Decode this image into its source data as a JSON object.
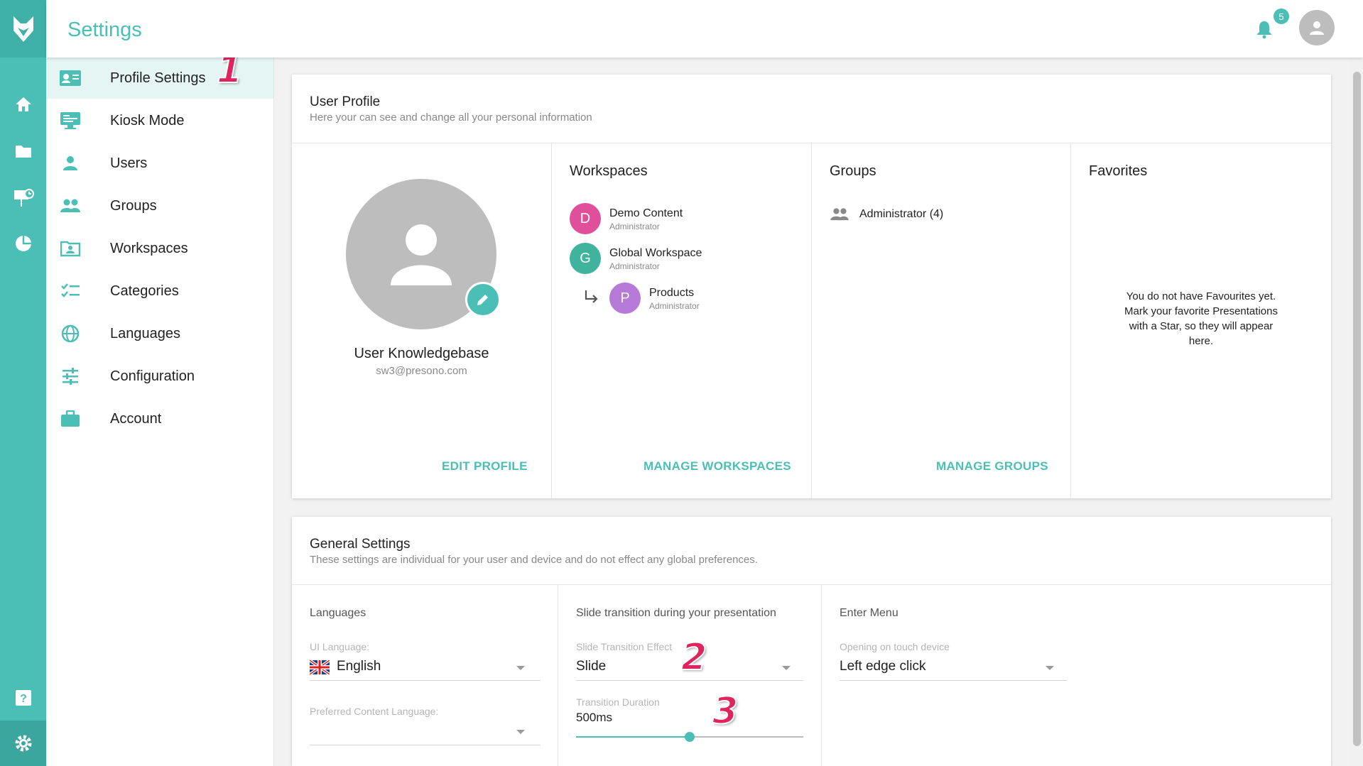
{
  "topbar": {
    "title": "Settings",
    "notification_count": "5"
  },
  "sidebar": {
    "items": [
      {
        "label": "Profile Settings",
        "icon": "profile-card-icon"
      },
      {
        "label": "Kiosk Mode",
        "icon": "monitor-icon"
      },
      {
        "label": "Users",
        "icon": "user-icon"
      },
      {
        "label": "Groups",
        "icon": "group-icon"
      },
      {
        "label": "Workspaces",
        "icon": "workspace-icon"
      },
      {
        "label": "Categories",
        "icon": "checklist-icon"
      },
      {
        "label": "Languages",
        "icon": "globe-icon"
      },
      {
        "label": "Configuration",
        "icon": "sliders-icon"
      },
      {
        "label": "Account",
        "icon": "briefcase-icon"
      }
    ]
  },
  "profile_card": {
    "title": "User Profile",
    "subtitle": "Here your can see and change all your personal information",
    "user": {
      "name": "User Knowledgebase",
      "email": "sw3@presono.com"
    },
    "edit_profile": "EDIT PROFILE",
    "workspaces": {
      "title": "Workspaces",
      "items": [
        {
          "initial": "D",
          "name": "Demo Content",
          "role": "Administrator",
          "color": "#e0509a"
        },
        {
          "initial": "G",
          "name": "Global Workspace",
          "role": "Administrator",
          "color": "#3fb39b"
        },
        {
          "initial": "P",
          "name": "Products",
          "role": "Administrator",
          "color": "#b57ad8"
        }
      ],
      "manage": "MANAGE WORKSPACES"
    },
    "groups": {
      "title": "Groups",
      "items": [
        {
          "name": "Administrator (4)"
        }
      ],
      "manage": "MANAGE GROUPS"
    },
    "favorites": {
      "title": "Favorites",
      "empty_line1": "You do not have Favourites yet.",
      "empty_line2": "Mark your favorite Presentations",
      "empty_line3": "with a Star, so they will appear",
      "empty_line4": "here."
    }
  },
  "general_card": {
    "title": "General Settings",
    "subtitle": "These settings are individual for your user and device and do not effect any global preferences.",
    "languages": {
      "section": "Languages",
      "ui_label": "UI Language:",
      "ui_value": "English",
      "content_label": "Preferred Content Language:",
      "content_value": ""
    },
    "transition": {
      "section": "Slide transition during your presentation",
      "effect_label": "Slide Transition Effect",
      "effect_value": "Slide",
      "duration_label": "Transition Duration",
      "duration_value": "500ms",
      "slider_fraction": 0.5
    },
    "enter_menu": {
      "section": "Enter Menu",
      "label": "Opening on touch device",
      "value": "Left edge click"
    }
  },
  "annotations": {
    "one": "1",
    "two": "2",
    "three": "3"
  },
  "colors": {
    "accent": "#4bbfb6",
    "accent_dark": "#3fb0a7",
    "annotation": "#e0245e"
  }
}
